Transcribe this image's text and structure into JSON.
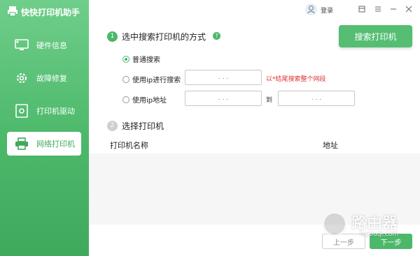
{
  "app": {
    "title": "快快打印机助手"
  },
  "sidebar": {
    "items": [
      {
        "label": "硬件信息",
        "icon": "monitor-icon"
      },
      {
        "label": "故障修复",
        "icon": "gear-icon"
      },
      {
        "label": "打印机驱动",
        "icon": "driver-icon"
      },
      {
        "label": "网络打印机",
        "icon": "printer-icon",
        "active": true
      }
    ]
  },
  "topbar": {
    "login": "登录"
  },
  "step1": {
    "num": "1",
    "title": "选中搜索打印机的方式",
    "help": "?",
    "search_button": "搜索打印机",
    "options": [
      {
        "label": "普通搜索",
        "selected": true
      },
      {
        "label": "使用ip进行搜索",
        "selected": false
      },
      {
        "label": "使用ip地址",
        "selected": false
      }
    ],
    "ip_placeholder": ".       .       .",
    "hint": "以*结尾搜索整个网段",
    "to": "到"
  },
  "step2": {
    "num": "2",
    "title": "选择打印机",
    "columns": [
      "打印机名称",
      "地址"
    ]
  },
  "footer": {
    "prev": "上一步",
    "next": "下一步"
  },
  "watermark": {
    "text": "路由器",
    "sub": "luyouqi.com"
  },
  "colors": {
    "accent": "#4cb86a",
    "hint": "#e03030"
  }
}
